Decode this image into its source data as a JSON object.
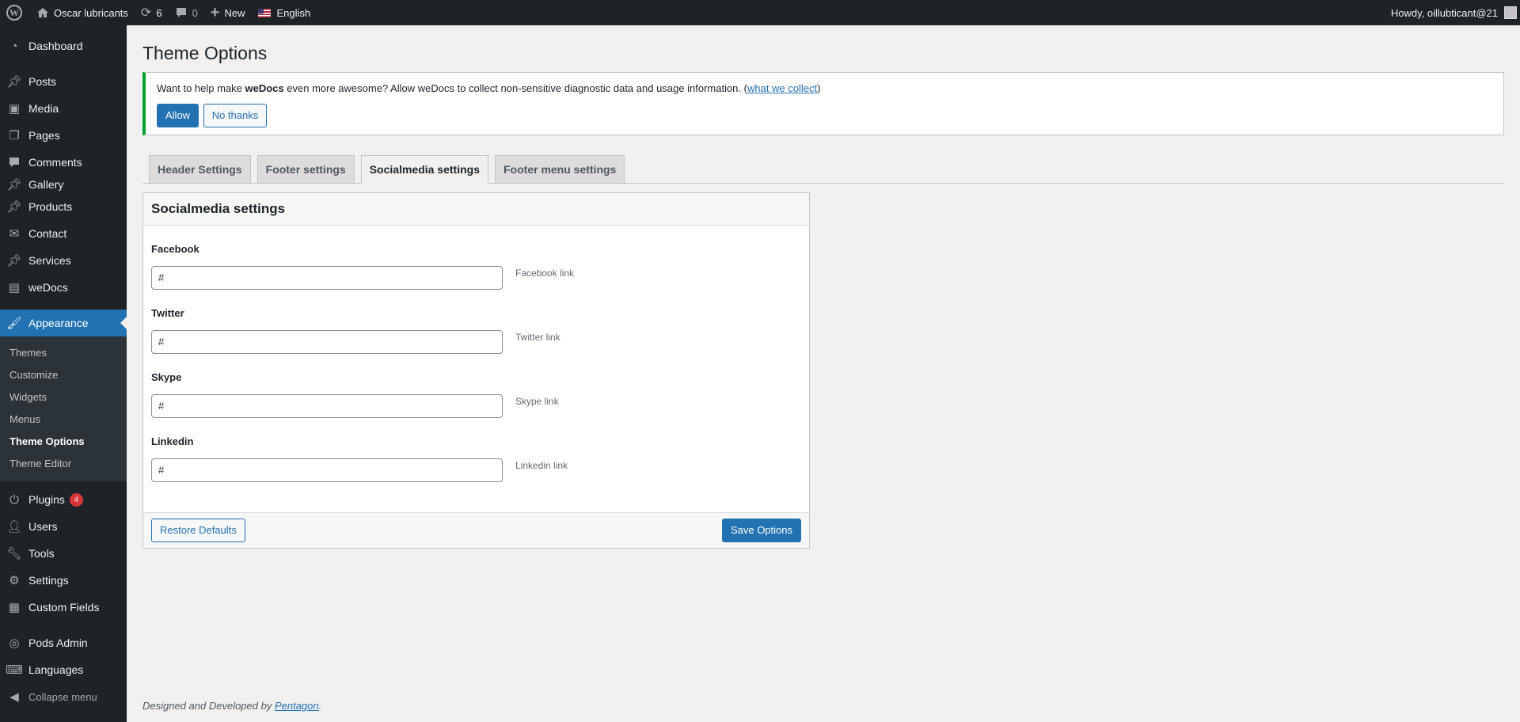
{
  "adminbar": {
    "site_name": "Oscar lubricants",
    "updates_count": "6",
    "comments_count": "0",
    "new_label": "New",
    "language": "English",
    "howdy": "Howdy, oillubticant@21"
  },
  "sidebar": {
    "items": [
      {
        "label": "Dashboard",
        "icon": "dashboard-icon"
      },
      {
        "label": "Posts",
        "icon": "pin-icon"
      },
      {
        "label": "Media",
        "icon": "media-icon"
      },
      {
        "label": "Pages",
        "icon": "pages-icon"
      },
      {
        "label": "Comments",
        "icon": "comment-icon"
      },
      {
        "label": "Gallery",
        "icon": "pin-icon"
      },
      {
        "label": "Products",
        "icon": "pin-icon"
      },
      {
        "label": "Contact",
        "icon": "email-icon"
      },
      {
        "label": "Services",
        "icon": "pin-icon"
      },
      {
        "label": "weDocs",
        "icon": "document-icon"
      },
      {
        "label": "Appearance",
        "icon": "brush-icon"
      },
      {
        "label": "Plugins",
        "icon": "plug-icon",
        "badge": "4"
      },
      {
        "label": "Users",
        "icon": "user-icon"
      },
      {
        "label": "Tools",
        "icon": "wrench-icon"
      },
      {
        "label": "Settings",
        "icon": "settings-icon"
      },
      {
        "label": "Custom Fields",
        "icon": "table-icon"
      },
      {
        "label": "Pods Admin",
        "icon": "pods-icon"
      },
      {
        "label": "Languages",
        "icon": "translate-icon"
      }
    ],
    "appearance_submenu": [
      "Themes",
      "Customize",
      "Widgets",
      "Menus",
      "Theme Options",
      "Theme Editor"
    ],
    "collapse_label": "Collapse menu"
  },
  "page": {
    "title": "Theme Options"
  },
  "notice": {
    "text_before": "Want to help make ",
    "brand": "weDocs",
    "text_after": " even more awesome? Allow weDocs to collect non-sensitive diagnostic data and usage information. (",
    "link": "what we collect",
    "text_end": ")",
    "allow_label": "Allow",
    "no_thanks_label": "No thanks"
  },
  "tabs": [
    "Header Settings",
    "Footer settings",
    "Socialmedia settings",
    "Footer menu settings"
  ],
  "panel": {
    "title": "Socialmedia settings",
    "fields": [
      {
        "label": "Facebook",
        "value": "#",
        "description": "Facebook link"
      },
      {
        "label": "Twitter",
        "value": "#",
        "description": "Twitter link"
      },
      {
        "label": "Skype",
        "value": "#",
        "description": "Skype link"
      },
      {
        "label": "Linkedin",
        "value": "#",
        "description": "Linkedin link"
      }
    ],
    "restore_label": "Restore Defaults",
    "save_label": "Save Options"
  },
  "footer": {
    "text": "Designed and Developed by ",
    "link": "Pentagon",
    "end": "."
  },
  "colors": {
    "admin_dark": "#1d2327",
    "accent": "#2271b1",
    "notice_border": "#00a32a",
    "badge": "#d63638"
  }
}
